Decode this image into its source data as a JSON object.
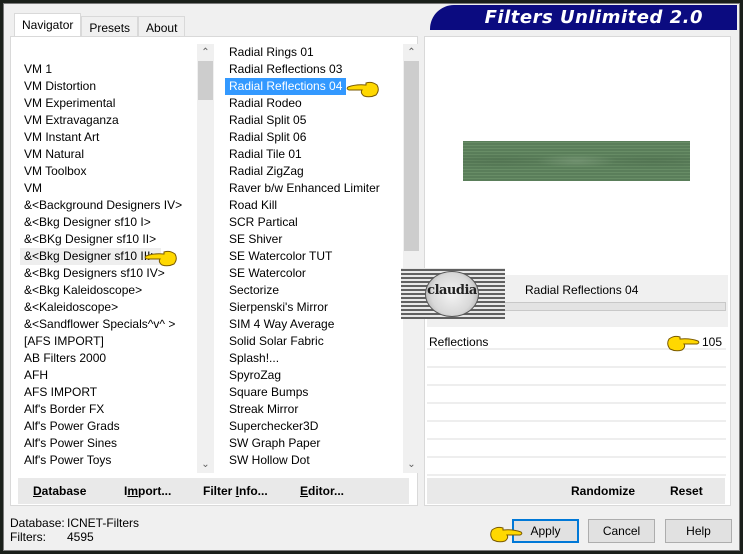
{
  "window": {
    "title": "Filters Unlimited 2.0"
  },
  "tabs": [
    {
      "label": "Navigator",
      "active": true
    },
    {
      "label": "Presets",
      "active": false
    },
    {
      "label": "About",
      "active": false
    }
  ],
  "categories": {
    "items": [
      "VM 1",
      "VM Distortion",
      "VM Experimental",
      "VM Extravaganza",
      "VM Instant Art",
      "VM Natural",
      "VM Toolbox",
      "VM",
      "&<Background Designers IV>",
      "&<Bkg Designer sf10 I>",
      "&<BKg Designer sf10 II>",
      "&<Bkg Designer sf10 III>",
      "&<Bkg Designers sf10 IV>",
      "&<Bkg Kaleidoscope>",
      "&<Kaleidoscope>",
      "&<Sandflower Specials^v^ >",
      "[AFS IMPORT]",
      "AB Filters 2000",
      "AFH",
      "AFS IMPORT",
      "Alf's Border FX",
      "Alf's Power Grads",
      "Alf's Power Sines",
      "Alf's Power Toys"
    ],
    "highlighted": "&<Bkg Designer sf10 III>"
  },
  "filters": {
    "items": [
      "Radial  Rings 01",
      "Radial Reflections 03",
      "Radial Reflections 04",
      "Radial Rodeo",
      "Radial Split 05",
      "Radial Split 06",
      "Radial Tile 01",
      "Radial ZigZag",
      "Raver b/w Enhanced Limiter",
      "Road Kill",
      "SCR  Partical",
      "SE Shiver",
      "SE Watercolor TUT",
      "SE Watercolor",
      "Sectorize",
      "Sierpenski's Mirror",
      "SIM 4 Way Average",
      "Solid Solar Fabric",
      "Splash!...",
      "SpyroZag",
      "Square Bumps",
      "Streak Mirror",
      "Superchecker3D",
      "SW Graph Paper",
      "SW Hollow Dot"
    ],
    "selected": "Radial Reflections 04"
  },
  "left_buttons": {
    "database": {
      "pre": "",
      "u": "D",
      "post": "atabase"
    },
    "import": {
      "pre": "I",
      "u": "m",
      "post": "port..."
    },
    "filter_info": {
      "pre": "Filter ",
      "u": "I",
      "post": "nfo..."
    },
    "editor": {
      "pre": "",
      "u": "E",
      "post": "ditor..."
    }
  },
  "preview": {
    "filter_name": "Radial Reflections 04",
    "params": [
      {
        "label": "Reflections",
        "value": "105"
      }
    ],
    "watermark": "claudia"
  },
  "right_buttons": {
    "randomize": "Randomize",
    "reset": "Reset"
  },
  "status": {
    "database_label": "Database:",
    "database_value": "ICNET-Filters",
    "filters_label": "Filters:",
    "filters_value": "4595"
  },
  "dialog_buttons": {
    "apply": "Apply",
    "cancel": "Cancel",
    "help": "Help"
  },
  "colors": {
    "title_bg": "#0b0b80",
    "selection": "#3399ff",
    "default_button_border": "#0078d7",
    "preview_green": "#5a7e5a"
  }
}
